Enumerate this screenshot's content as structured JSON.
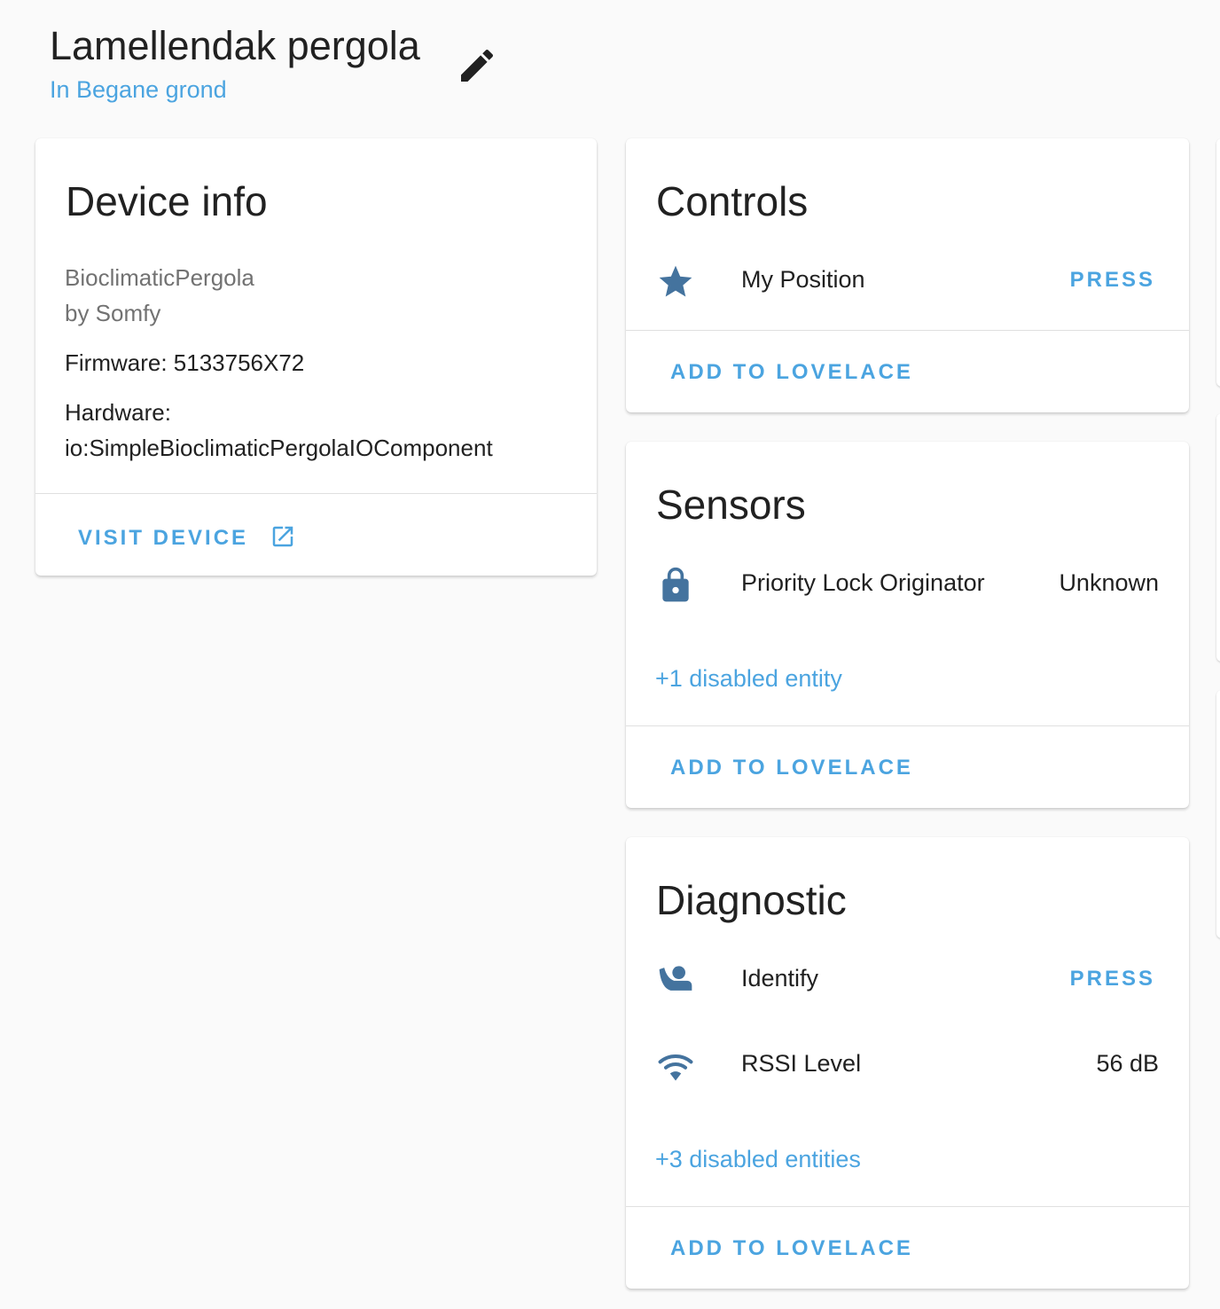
{
  "header": {
    "title": "Lamellendak pergola",
    "area": "In Begane grond"
  },
  "device_info": {
    "title": "Device info",
    "model": "BioclimaticPergola",
    "manufacturer": "by Somfy",
    "firmware": "Firmware: 5133756X72",
    "hardware_label": "Hardware:",
    "hardware_value": "io:SimpleBioclimaticPergolaIOComponent",
    "visit_label": "VISIT DEVICE"
  },
  "controls": {
    "title": "Controls",
    "rows": [
      {
        "icon": "star-icon",
        "name": "My Position",
        "action": "PRESS"
      }
    ],
    "add_label": "ADD TO LOVELACE"
  },
  "sensors": {
    "title": "Sensors",
    "rows": [
      {
        "icon": "lock-icon",
        "name": "Priority Lock Originator",
        "value": "Unknown"
      }
    ],
    "disabled": "+1 disabled entity",
    "add_label": "ADD TO LOVELACE"
  },
  "diagnostic": {
    "title": "Diagnostic",
    "rows": [
      {
        "icon": "identify-icon",
        "name": "Identify",
        "action": "PRESS"
      },
      {
        "icon": "wifi-icon",
        "name": "RSSI Level",
        "value": "56 dB"
      }
    ],
    "disabled": "+3 disabled entities",
    "add_label": "ADD TO LOVELACE"
  },
  "colors": {
    "accent": "#4ba4e0",
    "icon": "#44739e",
    "background": "#fafafa"
  }
}
